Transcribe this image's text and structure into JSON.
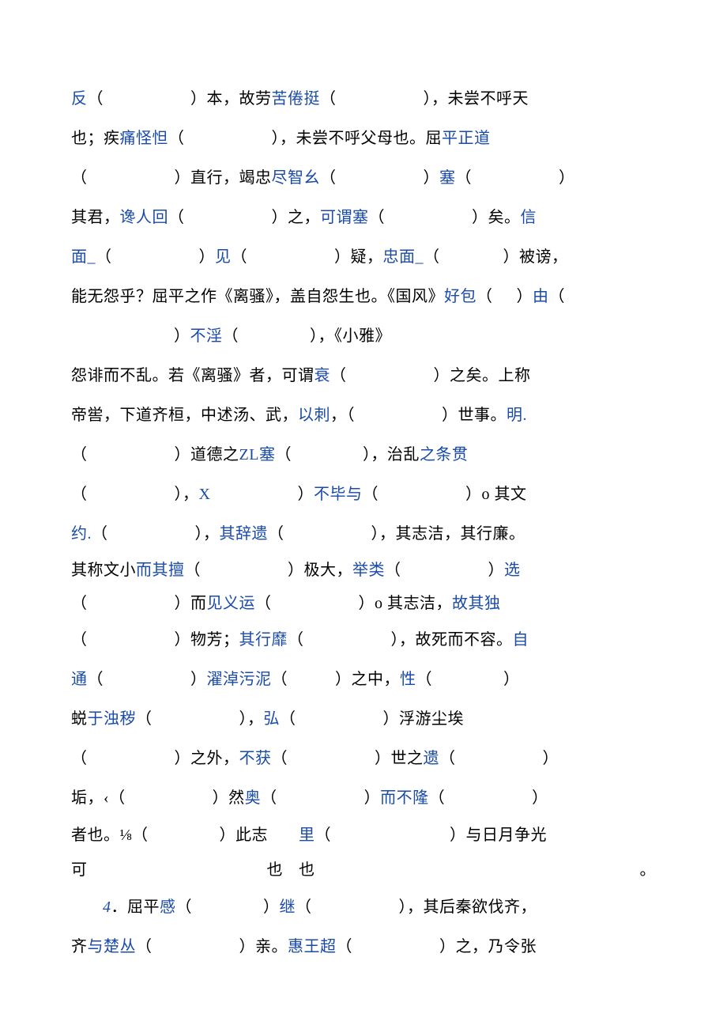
{
  "t": {
    "l1a": "反",
    "l1b": "（",
    "l1c": "）本，故劳",
    "l1d": "苦倦挺",
    "l1e": "（",
    "l1f": "），未尝不呼天",
    "l2a": "也；疾",
    "l2b": "痛怪怛",
    "l2c": "（",
    "l2d": "），未尝不呼父母也。屈",
    "l2e": "平正道",
    "l3a": "（",
    "l3b": "）直行，竭忠",
    "l3c": "尽智幺",
    "l3d": "（",
    "l3e": "）",
    "l3f": "塞",
    "l3g": "（",
    "l3h": "）",
    "l4a": "其君，",
    "l4b": "谗人回",
    "l4c": "（",
    "l4d": "）之，",
    "l4e": "可谓塞",
    "l4f": "（",
    "l4g": "）矣。",
    "l4h": "信",
    "l5a": "面_",
    "l5b": "（",
    "l5c": "）",
    "l5d": "见",
    "l5e": "（",
    "l5f": "）疑，",
    "l5g": "忠面_",
    "l5h": "（",
    "l5i": "）被谤，",
    "l6a": "能无怨乎？屈平之作《离骚》，盖自怨生也。《国风》",
    "l6b": "好包",
    "l6c": "（",
    "l6d": "）",
    "l6e": "由",
    "l6f": "（",
    "l7a": "）",
    "l7b": "不淫",
    "l7c": "（",
    "l7d": "），《小雅》",
    "l8a": "怨诽而不乱。若《离骚》者，可谓",
    "l8b": "衰",
    "l8c": "（",
    "l8d": "）之矣。上称",
    "l9a": "帝喾，下道齐桓，中述汤、武，",
    "l9b": "以刺",
    "l9c": "，（",
    "l9d": "）世事。",
    "l9e": "明.",
    "l10a": "（",
    "l10b": "）道德之",
    "l10c": "ZL",
    "l10d": "塞",
    "l10e": "（",
    "l10f": "），治乱",
    "l10g": "之条贯",
    "l11a": "（",
    "l11b": "），",
    "l11c": "X",
    "l11d": "）",
    "l11e": "不毕与",
    "l11f": "（",
    "l11g": "）o 其文",
    "l12a": "约.",
    "l12b": "（",
    "l12c": "），",
    "l12d": "其辞遗",
    "l12e": "（",
    "l12f": "），其志洁，其行廉。",
    "l13a": "其称文小",
    "l13b": "而其擅",
    "l13c": "（",
    "l13d": "）极大，",
    "l13e": "举类",
    "l13f": "（",
    "l13g": "）",
    "l13h": "选",
    "l14a": "（",
    "l14b": "）而",
    "l14c": "见义运",
    "l14d": "（",
    "l14e": "）o 其志洁，",
    "l14f": "故其独",
    "l15a": "（",
    "l15b": "）物芳；",
    "l15c": "其行靡",
    "l15d": "（",
    "l15e": "），故死而不容。",
    "l15f": "自",
    "l16a": "通",
    "l16b": "（",
    "l16c": "）",
    "l16d": "濯淖污泥",
    "l16e": "（",
    "l16f": "）之中，",
    "l16g": "性",
    "l16h": "（",
    "l16i": "）",
    "l17a": "蜕",
    "l17b": "于浊秽",
    "l17c": "（",
    "l17d": "），",
    "l17e": "弘",
    "l17f": "（",
    "l17g": "）浮游尘埃",
    "l18a": "（",
    "l18b": "）之外，",
    "l18c": "不获",
    "l18d": "（",
    "l18e": "）世之",
    "l18f": "遗",
    "l18g": "（",
    "l18h": "）",
    "l19a": "垢，‹（",
    "l19b": "）然",
    "l19c": "奥",
    "l19d": "（",
    "l19e": "）",
    "l19f": "而不隆",
    "l19g": "（",
    "l19h": "）",
    "l20a": "者也。⅛（",
    "l20aa": "可",
    "l20b": "）此志",
    "l20bb": "也",
    "l20c": "里",
    "l20cc": "也",
    "l20d": "（",
    "l20e": "）与日月争光",
    "l20f": "。",
    "l21a": "4",
    "l21b": "．屈平",
    "l21c": "感",
    "l21d": "（",
    "l21e": "）",
    "l21f": "继",
    "l21g": "（",
    "l21h": "），其后秦欲伐齐，",
    "l22a": "齐",
    "l22b": "与楚丛",
    "l22c": "（",
    "l22d": "）亲。",
    "l22e": "惠王超",
    "l22f": "（",
    "l22g": "）之，乃令张"
  }
}
